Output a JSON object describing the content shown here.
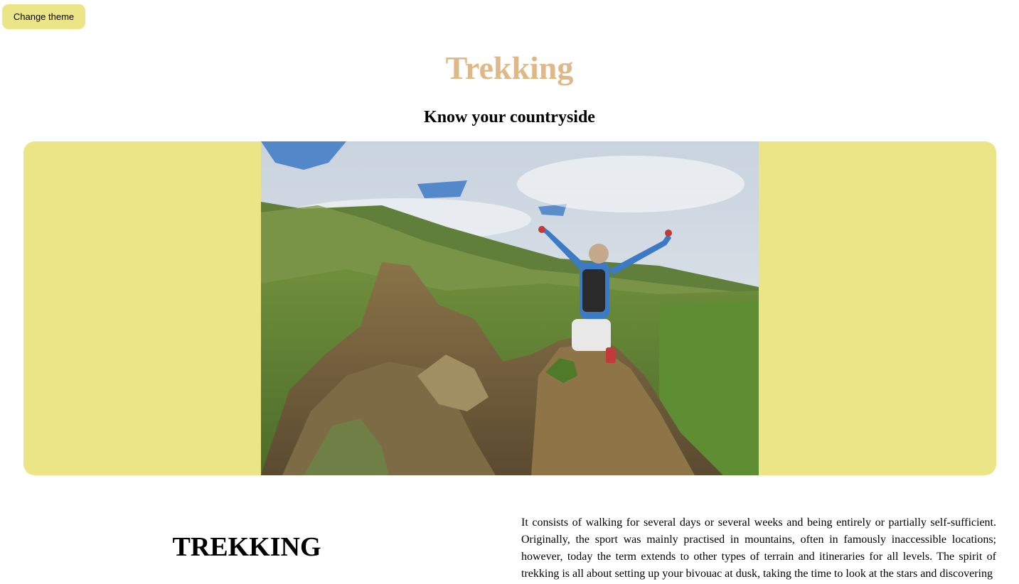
{
  "header": {
    "theme_button_label": "Change theme",
    "title": "Trekking",
    "subtitle": "Know your countryside"
  },
  "hero": {
    "image_icon": "hiker-on-mountain-photo",
    "panel_color": "#ebe587"
  },
  "section": {
    "heading": "TREKKING",
    "body": "It consists of walking for several days or several weeks and being entirely or partially self-sufficient. Originally, the sport was mainly practised in mountains, often in famously inaccessible locations; however, today the term extends to other types of terrain and itineraries for all levels. The spirit of trekking is all about setting up your bivouac at dusk, taking the time to look at the stars and discovering"
  },
  "colors": {
    "accent": "#ebe587",
    "title": "#deb887"
  }
}
